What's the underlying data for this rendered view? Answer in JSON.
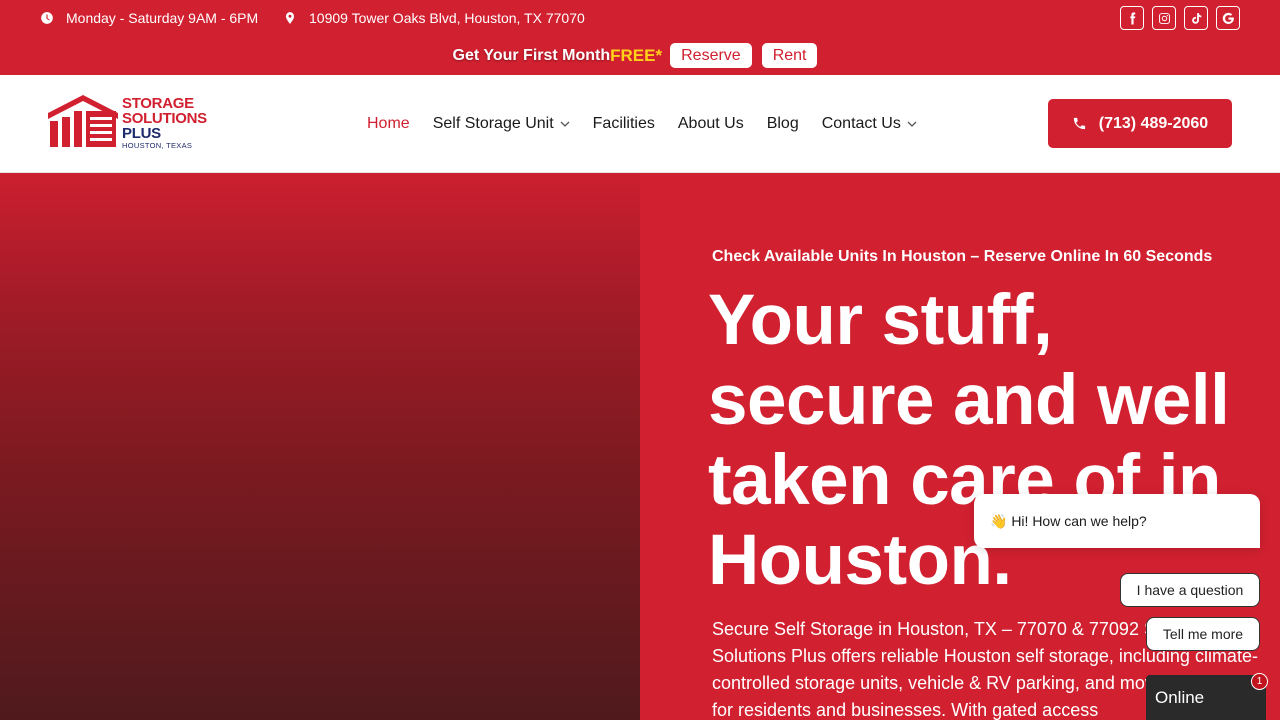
{
  "topbar": {
    "hours": "Monday - Saturday 9AM - 6PM",
    "address": "10909 Tower Oaks Blvd, Houston, TX 77070",
    "social": [
      "facebook-icon",
      "instagram-icon",
      "tiktok-icon",
      "google-icon"
    ],
    "promo": {
      "text": "Get Your First Month",
      "free": "FREE*",
      "reserve_label": "Reserve",
      "rent_label": "Rent"
    }
  },
  "logo": {
    "line1": "STORAGE",
    "line2": "SOLUTIONS",
    "line3": "PLUS",
    "line4": "HOUSTON, TEXAS"
  },
  "nav": {
    "items": [
      {
        "label": "Home",
        "active": true,
        "dropdown": false
      },
      {
        "label": "Self Storage Unit",
        "active": false,
        "dropdown": true
      },
      {
        "label": "Facilities",
        "active": false,
        "dropdown": false
      },
      {
        "label": "About Us",
        "active": false,
        "dropdown": false
      },
      {
        "label": "Blog",
        "active": false,
        "dropdown": false
      },
      {
        "label": "Contact Us",
        "active": false,
        "dropdown": true
      }
    ],
    "phone": "(713) 489-2060"
  },
  "hero": {
    "kicker": "Check Available Units In Houston – Reserve Online In 60 Seconds",
    "headline": "Your stuff, secure and well taken care of in Houston.",
    "sub": "Secure Self Storage in Houston, TX – 77070 & 77092 Storage Solutions Plus offers reliable Houston self storage, including climate-controlled storage units, vehicle & RV parking, and moving supplies for residents and businesses. With gated access"
  },
  "chat": {
    "greeting": "👋 Hi! How can we help?",
    "option1": "I have a question",
    "option2": "Tell me more",
    "status": "Online",
    "badge_count": "1"
  },
  "colors": {
    "brand_red": "#d12030",
    "navy": "#1d2a6b",
    "promo_yellow": "#ffd21a"
  }
}
